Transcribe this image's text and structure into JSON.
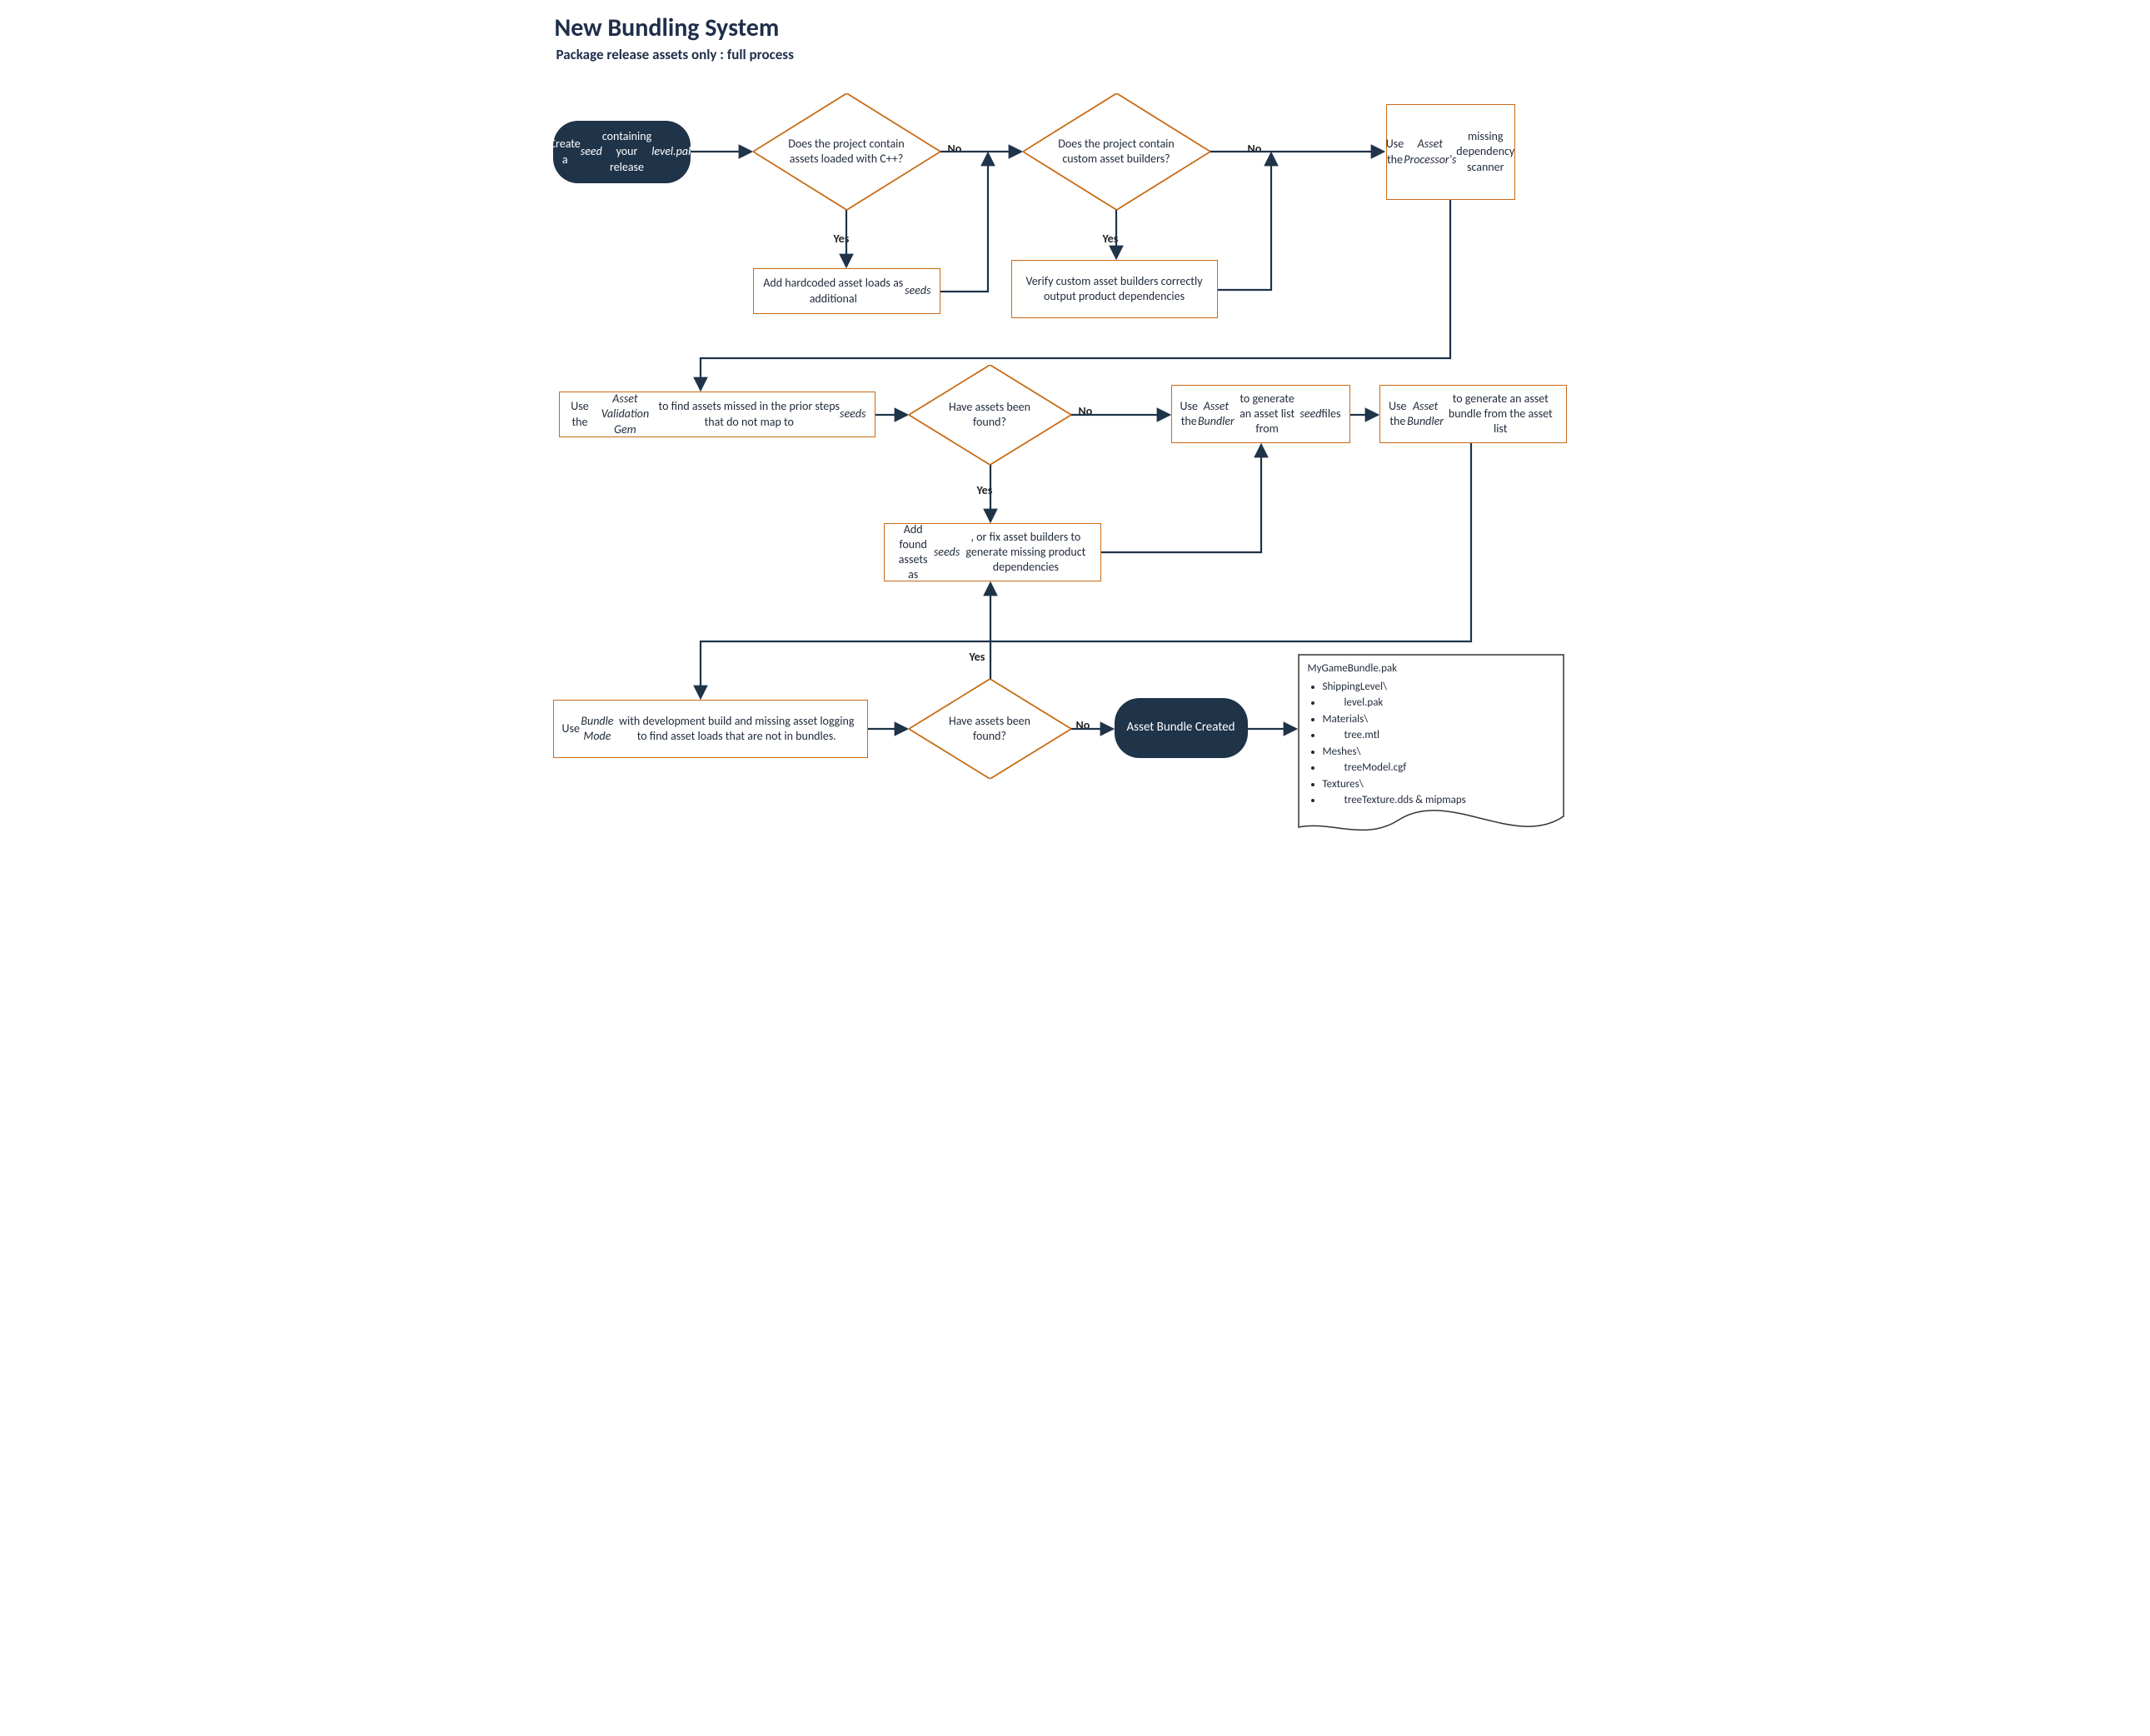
{
  "title": "New Bundling System",
  "subtitle": "Package release assets only : full process",
  "nodes": {
    "start_seed": "Create a <em>seed</em> containing your release <em>level.pak</em>",
    "d_cxx": "Does the project contain assets loaded with C++?",
    "d_builders": "Does the project contain custom asset builders?",
    "use_ap_scanner": "Use the <em>Asset Processor's</em> missing dependency scanner",
    "add_hardcoded": "Add hardcoded asset loads as additional <em>seeds</em>",
    "verify_builders": "Verify custom asset builders correctly output product dependencies",
    "use_avg": "Use the <em>Asset Validation Gem</em> to find assets missed in the prior steps that do not map to <em>seeds</em>",
    "d_found1": "Have assets been found?",
    "gen_list": "Use the <em>Asset Bundler</em> to generate an asset list from <em>seed</em> files",
    "gen_bundle": "Use the <em>Asset Bundler</em> to generate an asset bundle from the asset list",
    "add_found": "Add found assets as <em>seeds</em>, or fix asset builders to generate missing product dependencies",
    "use_bundle_mode": "Use <em>Bundle Mode</em> with development build and missing asset logging to find asset loads that are not in bundles.",
    "d_found2": "Have assets been found?",
    "created": "Asset Bundle Created"
  },
  "labels": {
    "yes": "Yes",
    "no": "No"
  },
  "doc": {
    "header": "MyGameBundle.pak",
    "items": [
      {
        "t": "ShippingLevel\\",
        "ind": false
      },
      {
        "t": "level.pak",
        "ind": true
      },
      {
        "t": "Materials\\",
        "ind": false
      },
      {
        "t": "tree.mtl",
        "ind": true
      },
      {
        "t": "Meshes\\",
        "ind": false
      },
      {
        "t": "treeModel.cgf",
        "ind": true
      },
      {
        "t": "Textures\\",
        "ind": false
      },
      {
        "t": "treeTexture.dds & mipmaps",
        "ind": true
      }
    ]
  }
}
